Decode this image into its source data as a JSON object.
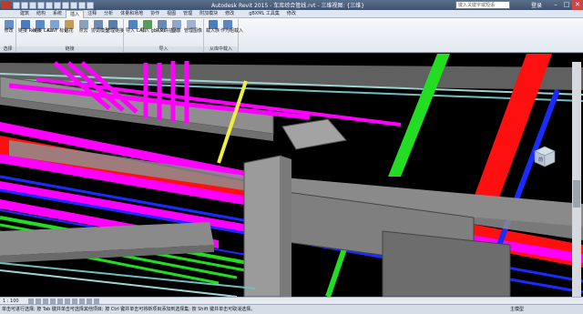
{
  "window": {
    "title": "Autodesk Revit 2015 - 车库综合管线.rvt - 三维视图: {三维}",
    "search_placeholder": "键入关键字或短语",
    "login_label": "登录",
    "controls": [
      "–",
      "□",
      "✕"
    ]
  },
  "ribbon_tabs": [
    {
      "label": "建筑",
      "active": false
    },
    {
      "label": "结构",
      "active": false
    },
    {
      "label": "系统",
      "active": false
    },
    {
      "label": "插入",
      "active": true
    },
    {
      "label": "注释",
      "active": false
    },
    {
      "label": "分析",
      "active": false
    },
    {
      "label": "体量和场地",
      "active": false
    },
    {
      "label": "协作",
      "active": false
    },
    {
      "label": "视图",
      "active": false
    },
    {
      "label": "管理",
      "active": false
    },
    {
      "label": "附加模块",
      "active": false
    },
    {
      "label": "修改",
      "active": false
    },
    {
      "label": "",
      "active": false
    },
    {
      "label": "gBXML 工具集",
      "active": false
    },
    {
      "label": "修改",
      "active": false
    }
  ],
  "ribbon": {
    "groups": [
      {
        "label": "选择",
        "tools": [
          {
            "label": "修改",
            "icon": "modify-icon",
            "color": "#6a8fc8"
          }
        ]
      },
      {
        "label": "链接",
        "tools": [
          {
            "label": "链接 Revit",
            "icon": "link-revit-icon",
            "color": "#4a7bbf"
          },
          {
            "label": "链接 CAD",
            "icon": "link-cad-icon",
            "color": "#5a8bc5"
          },
          {
            "label": "DWF 标记",
            "icon": "dwf-icon",
            "color": "#7fa2cf"
          },
          {
            "label": "贴花",
            "icon": "decal-icon",
            "color": "#c49a5a"
          },
          {
            "label": "点云",
            "icon": "point-cloud-icon",
            "color": "#8aa0b8"
          },
          {
            "label": "协调模型",
            "icon": "coordination-icon",
            "color": "#6f8ab0"
          },
          {
            "label": "管理链接",
            "icon": "manage-links-icon",
            "color": "#5b7ea8"
          }
        ]
      },
      {
        "label": "导入",
        "tools": [
          {
            "label": "导入 CAD",
            "icon": "import-cad-icon",
            "color": "#4f83c2"
          },
          {
            "label": "导入 gbXML",
            "icon": "import-gbxml-icon",
            "color": "#5c9a5c"
          },
          {
            "label": "从文件插入",
            "icon": "insert-from-file-icon",
            "color": "#6c88b0"
          },
          {
            "label": "图像",
            "icon": "image-icon",
            "color": "#8fa8c8"
          },
          {
            "label": "管理图像",
            "icon": "manage-images-icon",
            "color": "#9fb3cc"
          }
        ]
      },
      {
        "label": "从库中载入",
        "tools": [
          {
            "label": "载入族",
            "icon": "load-family-icon",
            "color": "#4d7cb8"
          },
          {
            "label": "作为组载入",
            "icon": "load-as-group-icon",
            "color": "#5c86bd"
          }
        ]
      }
    ]
  },
  "viewcube": {
    "face_label": "前"
  },
  "view_control_bar": {
    "scale": "1 : 100"
  },
  "status_bar": {
    "hint": "单击可进行选择; 按 Tab 键并单击可选择其他项目; 按 Ctrl 键并单击可将新项目添加到选择集; 按 Shift 键并单击可取消选择。",
    "right_label": "主模型"
  },
  "colors": {
    "magenta_pipe": "#ff00ff",
    "red_duct": "#ff1010",
    "blue_pipe": "#1a2bff",
    "green_pipe": "#22dd22",
    "yellow_pipe": "#eeee44",
    "cyan_pipe": "#44dddd",
    "beam_grey": "#8e8e8e"
  }
}
